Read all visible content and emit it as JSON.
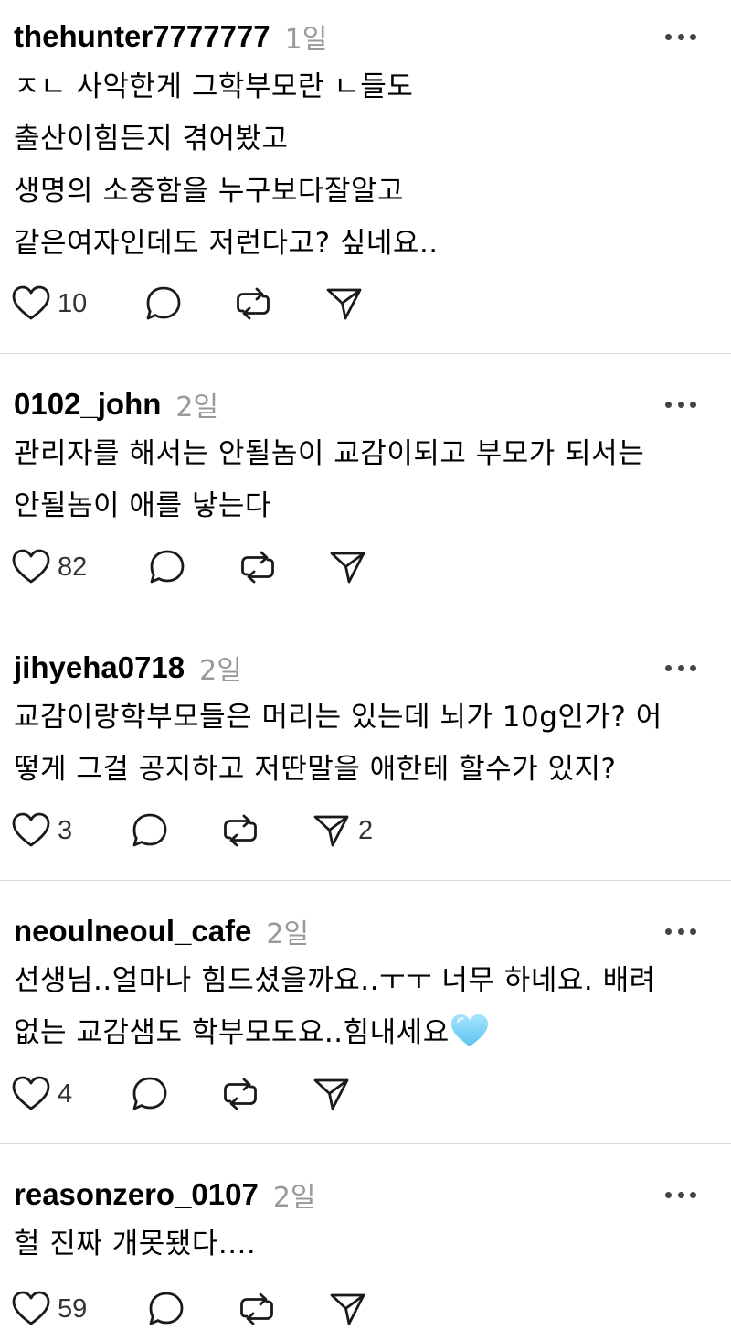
{
  "posts": [
    {
      "username": "thehunter7777777",
      "time": "1일",
      "lines": [
        "ㅈㄴ 사악한게 그학부모란 ㄴ들도",
        "출산이힘든지 겪어봤고",
        "생명의 소중함을 누구보다잘알고",
        "같은여자인데도 저런다고? 싶네요.."
      ],
      "likes": "10",
      "shares": ""
    },
    {
      "username": "0102_john",
      "time": "2일",
      "lines": [
        "관리자를 해서는 안될놈이 교감이되고 부모가 되서는",
        "안될놈이 애를 낳는다"
      ],
      "likes": "82",
      "shares": ""
    },
    {
      "username": "jihyeha0718",
      "time": "2일",
      "lines": [
        "교감이랑학부모들은 머리는 있는데 뇌가 10g인가? 어",
        "떻게 그걸 공지하고 저딴말을 애한테 할수가 있지?"
      ],
      "likes": "3",
      "shares": "2"
    },
    {
      "username": "neoulneoul_cafe",
      "time": "2일",
      "lines": [
        "선생님..얼마나 힘드셨을까요..ㅜㅜ 너무 하네요. 배려",
        "없는 교감샘도 학부모도요..힘내세요"
      ],
      "emoji": "light-blue-heart-icon",
      "likes": "4",
      "shares": ""
    },
    {
      "username": "reasonzero_0107",
      "time": "2일",
      "lines": [
        "헐 진짜 개못됐다...."
      ],
      "likes": "59",
      "shares": ""
    }
  ],
  "icons": {
    "like": "heart-icon",
    "comment": "comment-bubble-icon",
    "repost": "repost-icon",
    "share": "send-icon",
    "more": "more-options-icon"
  },
  "colors": {
    "text": "#000000",
    "muted": "#999999",
    "divider": "#dbdbdb",
    "emoji_heart": "#7fd3f7"
  }
}
